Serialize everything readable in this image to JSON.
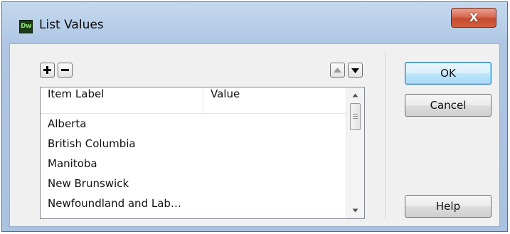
{
  "window": {
    "title": "List Values",
    "app_icon_text": "Dw",
    "close_glyph": "X"
  },
  "toolbar": {
    "add_icon": "plus-icon",
    "remove_icon": "minus-icon",
    "move_up_icon": "triangle-up-icon",
    "move_down_icon": "triangle-down-icon"
  },
  "list": {
    "columns": [
      "Item Label",
      "Value"
    ],
    "rows": [
      {
        "label": "Alberta",
        "value": ""
      },
      {
        "label": "British Columbia",
        "value": ""
      },
      {
        "label": "Manitoba",
        "value": ""
      },
      {
        "label": "New Brunswick",
        "value": ""
      },
      {
        "label": "Newfoundland and Lab…",
        "value": ""
      }
    ]
  },
  "buttons": {
    "ok": "OK",
    "cancel": "Cancel",
    "help": "Help"
  },
  "colors": {
    "close_button": "#c74a30",
    "default_button": "#bee6fd"
  }
}
